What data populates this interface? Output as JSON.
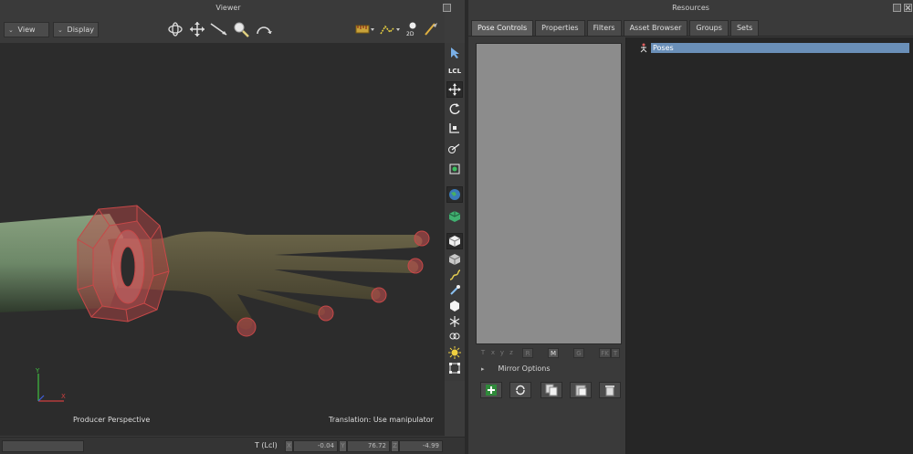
{
  "viewer": {
    "title": "Viewer",
    "menus": {
      "view": "View",
      "display": "Display"
    },
    "labels": {
      "camera": "Producer Perspective",
      "status_message": "Translation: Use manipulator"
    },
    "status": {
      "mode": "T (Lcl)",
      "x_tag": "X",
      "y_tag": "Y",
      "z_tag": "Z",
      "x": "-0.04",
      "y": "76.72",
      "z": "-4.99"
    },
    "tool_icons": [
      "select-arrow-icon",
      "local-lcl-icon",
      "translate-icon",
      "rotate-icon",
      "scale-icon",
      "ik-reach-icon",
      "marker-icon",
      "globe-icon",
      "cube-green-icon",
      "cube-white-icon",
      "cube-gray-icon",
      "path-icon",
      "rocket-icon",
      "sphere-icon",
      "skeleton-icon",
      "link-icon",
      "light-icon",
      "frame-icon"
    ],
    "lcl_label": "LCL",
    "toolbar_2d_label": "2D"
  },
  "resources": {
    "title": "Resources",
    "tabs": [
      "Pose Controls",
      "Properties",
      "Filters",
      "Asset Browser",
      "Groups",
      "Sets"
    ],
    "active_tab": "Pose Controls",
    "pose_options": [
      "T",
      "x",
      "y",
      "z",
      "R",
      "M",
      "G",
      "FK",
      "T"
    ],
    "mirror_options": "Mirror Options",
    "tree_item": "Poses",
    "actions": [
      "add-pose-icon",
      "refresh-icon",
      "copy-icon",
      "paste-icon",
      "delete-icon"
    ]
  },
  "colors": {
    "accent_selection": "#6a8fb8",
    "viewport_bg": "#2c2c2c",
    "arm_green": "#6f8a6a",
    "hand_skin": "#4d4834",
    "manipulator_red": "#c74848"
  }
}
